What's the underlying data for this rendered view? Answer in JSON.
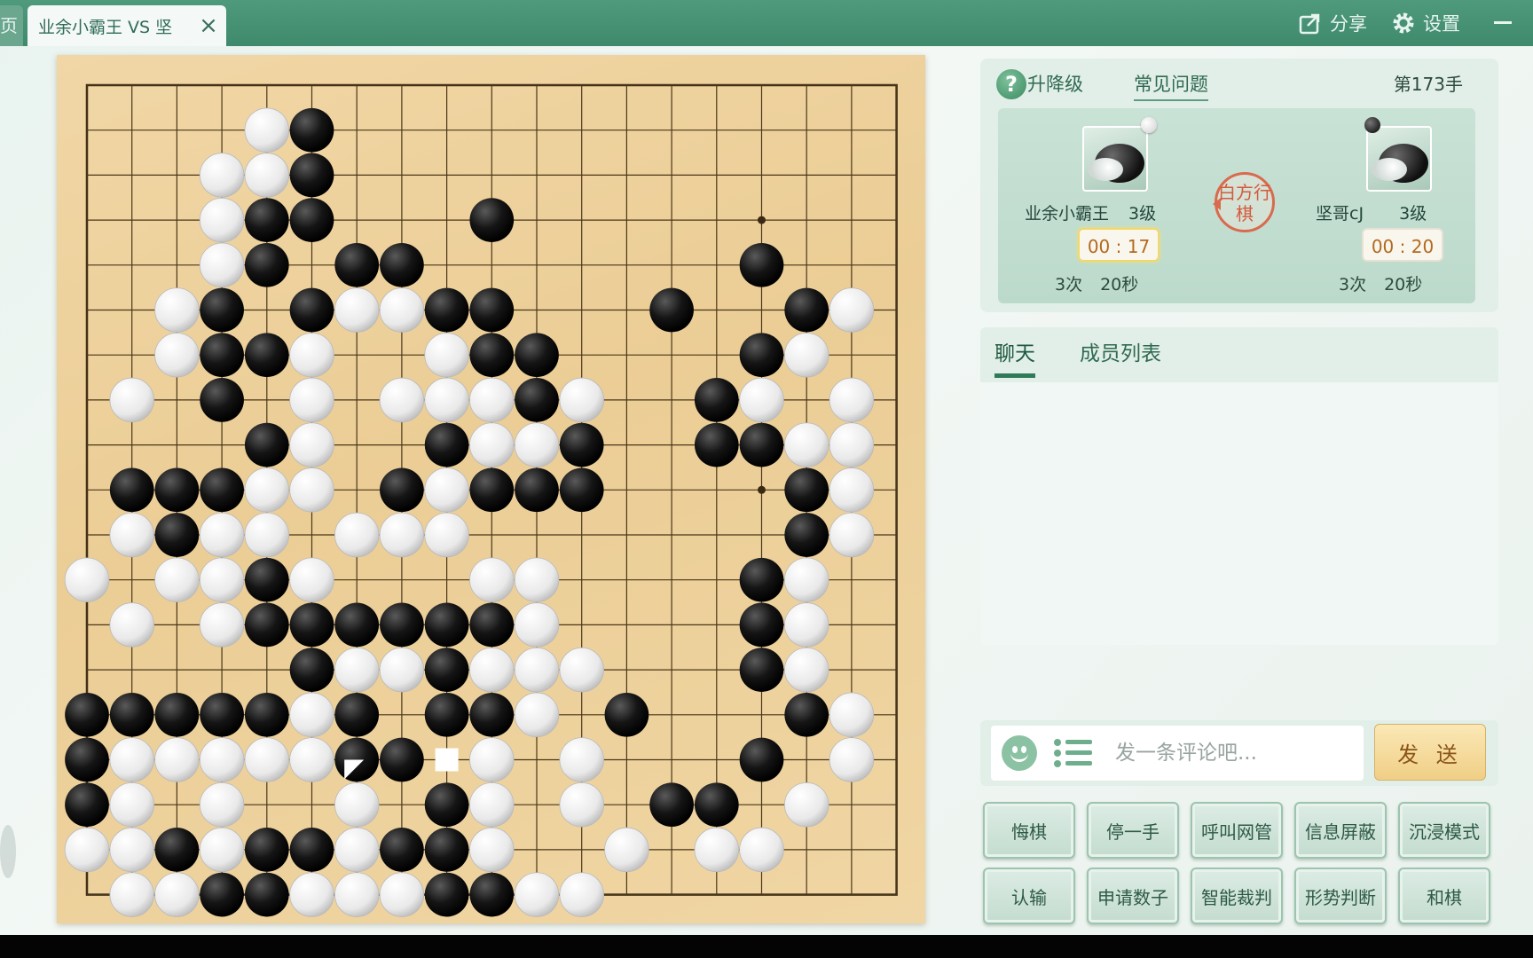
{
  "tabs": {
    "left_stub_label": "页",
    "active_title": "业余小霸王 VS 坚",
    "close_icon": "×"
  },
  "top_actions": {
    "share": "分享",
    "settings": "设置"
  },
  "info": {
    "help_icon": "?",
    "level_link": "升降级",
    "faq_link": "常见问题",
    "move_count": "第173手",
    "turn_seal": "白方行棋",
    "player1": {
      "name": "业余小霸王",
      "rank": "3级",
      "timer": "00 : 17",
      "byo_count": "3次",
      "byo_time": "20秒",
      "stone": "white"
    },
    "player2": {
      "name": "坚哥cJ",
      "rank": "3级",
      "timer": "00 : 20",
      "byo_count": "3次",
      "byo_time": "20秒",
      "stone": "black"
    }
  },
  "chat": {
    "tabs": [
      "聊天",
      "成员列表"
    ],
    "active_tab": 0,
    "input_placeholder": "发一条评论吧...",
    "send_label": "发 送"
  },
  "actions": [
    "悔棋",
    "停一手",
    "呼叫网管",
    "信息屏蔽",
    "沉浸模式",
    "认输",
    "申请数子",
    "智能裁判",
    "形势判断",
    "和棋"
  ],
  "board": {
    "size": 19,
    "star_points": [
      [
        3,
        3
      ],
      [
        3,
        9
      ],
      [
        3,
        15
      ],
      [
        9,
        3
      ],
      [
        9,
        9
      ],
      [
        9,
        15
      ],
      [
        15,
        3
      ],
      [
        15,
        9
      ],
      [
        15,
        15
      ]
    ],
    "black": [
      [
        5,
        1
      ],
      [
        5,
        2
      ],
      [
        4,
        3
      ],
      [
        5,
        3
      ],
      [
        9,
        3
      ],
      [
        4,
        4
      ],
      [
        6,
        4
      ],
      [
        7,
        4
      ],
      [
        15,
        4
      ],
      [
        3,
        5
      ],
      [
        5,
        5
      ],
      [
        8,
        5
      ],
      [
        9,
        5
      ],
      [
        13,
        5
      ],
      [
        16,
        5
      ],
      [
        3,
        6
      ],
      [
        4,
        6
      ],
      [
        9,
        6
      ],
      [
        10,
        6
      ],
      [
        15,
        6
      ],
      [
        3,
        7
      ],
      [
        10,
        7
      ],
      [
        14,
        7
      ],
      [
        4,
        8
      ],
      [
        8,
        8
      ],
      [
        11,
        8
      ],
      [
        14,
        8
      ],
      [
        15,
        8
      ],
      [
        1,
        9
      ],
      [
        2,
        9
      ],
      [
        3,
        9
      ],
      [
        7,
        9
      ],
      [
        9,
        9
      ],
      [
        10,
        9
      ],
      [
        11,
        9
      ],
      [
        16,
        9
      ],
      [
        2,
        10
      ],
      [
        16,
        10
      ],
      [
        4,
        11
      ],
      [
        15,
        11
      ],
      [
        4,
        12
      ],
      [
        5,
        12
      ],
      [
        6,
        12
      ],
      [
        7,
        12
      ],
      [
        8,
        12
      ],
      [
        9,
        12
      ],
      [
        15,
        12
      ],
      [
        5,
        13
      ],
      [
        8,
        13
      ],
      [
        15,
        13
      ],
      [
        0,
        14
      ],
      [
        1,
        14
      ],
      [
        2,
        14
      ],
      [
        3,
        14
      ],
      [
        4,
        14
      ],
      [
        6,
        14
      ],
      [
        8,
        14
      ],
      [
        9,
        14
      ],
      [
        12,
        14
      ],
      [
        16,
        14
      ],
      [
        0,
        15
      ],
      [
        6,
        15
      ],
      [
        7,
        15
      ],
      [
        15,
        15
      ],
      [
        0,
        16
      ],
      [
        8,
        16
      ],
      [
        13,
        16
      ],
      [
        14,
        16
      ],
      [
        2,
        17
      ],
      [
        4,
        17
      ],
      [
        5,
        17
      ],
      [
        7,
        17
      ],
      [
        8,
        17
      ],
      [
        3,
        18
      ],
      [
        4,
        18
      ],
      [
        8,
        18
      ],
      [
        9,
        18
      ]
    ],
    "white": [
      [
        4,
        1
      ],
      [
        3,
        2
      ],
      [
        4,
        2
      ],
      [
        3,
        3
      ],
      [
        3,
        4
      ],
      [
        2,
        5
      ],
      [
        6,
        5
      ],
      [
        7,
        5
      ],
      [
        17,
        5
      ],
      [
        2,
        6
      ],
      [
        5,
        6
      ],
      [
        8,
        6
      ],
      [
        16,
        6
      ],
      [
        1,
        7
      ],
      [
        5,
        7
      ],
      [
        7,
        7
      ],
      [
        8,
        7
      ],
      [
        9,
        7
      ],
      [
        11,
        7
      ],
      [
        15,
        7
      ],
      [
        17,
        7
      ],
      [
        5,
        8
      ],
      [
        9,
        8
      ],
      [
        10,
        8
      ],
      [
        16,
        8
      ],
      [
        17,
        8
      ],
      [
        4,
        9
      ],
      [
        5,
        9
      ],
      [
        8,
        9
      ],
      [
        17,
        9
      ],
      [
        1,
        10
      ],
      [
        3,
        10
      ],
      [
        4,
        10
      ],
      [
        6,
        10
      ],
      [
        7,
        10
      ],
      [
        8,
        10
      ],
      [
        17,
        10
      ],
      [
        0,
        11
      ],
      [
        2,
        11
      ],
      [
        3,
        11
      ],
      [
        5,
        11
      ],
      [
        9,
        11
      ],
      [
        10,
        11
      ],
      [
        16,
        11
      ],
      [
        1,
        12
      ],
      [
        3,
        12
      ],
      [
        10,
        12
      ],
      [
        16,
        12
      ],
      [
        6,
        13
      ],
      [
        7,
        13
      ],
      [
        9,
        13
      ],
      [
        10,
        13
      ],
      [
        11,
        13
      ],
      [
        16,
        13
      ],
      [
        5,
        14
      ],
      [
        10,
        14
      ],
      [
        17,
        14
      ],
      [
        1,
        15
      ],
      [
        2,
        15
      ],
      [
        3,
        15
      ],
      [
        4,
        15
      ],
      [
        5,
        15
      ],
      [
        9,
        15
      ],
      [
        11,
        15
      ],
      [
        17,
        15
      ],
      [
        1,
        16
      ],
      [
        3,
        16
      ],
      [
        6,
        16
      ],
      [
        9,
        16
      ],
      [
        11,
        16
      ],
      [
        16,
        16
      ],
      [
        0,
        17
      ],
      [
        1,
        17
      ],
      [
        3,
        17
      ],
      [
        6,
        17
      ],
      [
        9,
        17
      ],
      [
        12,
        17
      ],
      [
        14,
        17
      ],
      [
        15,
        17
      ],
      [
        1,
        18
      ],
      [
        2,
        18
      ],
      [
        5,
        18
      ],
      [
        6,
        18
      ],
      [
        7,
        18
      ],
      [
        10,
        18
      ],
      [
        11,
        18
      ]
    ],
    "last_move_marker": [
      6,
      15
    ],
    "pending_move_marker": [
      8,
      15
    ]
  }
}
